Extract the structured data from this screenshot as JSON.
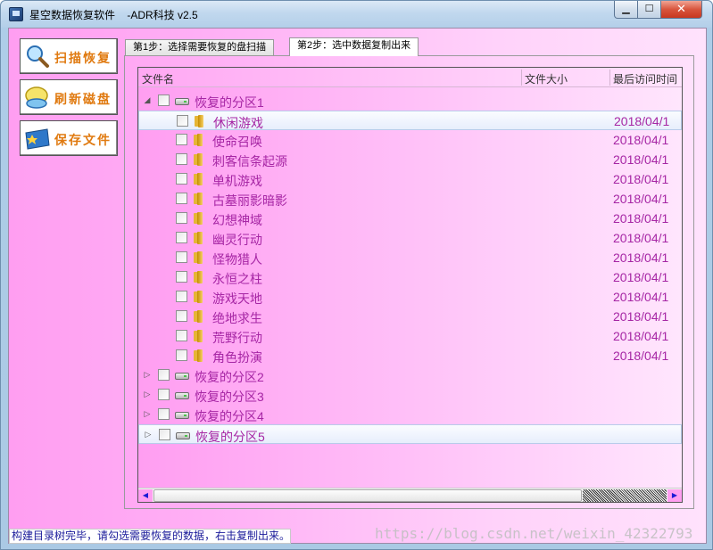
{
  "window": {
    "title": "星空数据恢复软件    -ADR科技 v2.5",
    "minimize_glyph": "▁",
    "maximize_glyph": "☐",
    "close_glyph": "✕"
  },
  "sidebar": {
    "buttons": [
      {
        "label": "扫描恢复",
        "icon": "magnifier-icon"
      },
      {
        "label": "刷新磁盘",
        "icon": "refresh-disk-icon"
      },
      {
        "label": "保存文件",
        "icon": "save-file-icon"
      }
    ]
  },
  "tabs": [
    {
      "label": "第1步：选择需要恢复的盘扫描",
      "active": false
    },
    {
      "label": "第2步：选中数据复制出来",
      "active": true
    }
  ],
  "tree": {
    "columns": [
      "文件名",
      "文件大小",
      "最后访问时间"
    ],
    "partition1": {
      "label": "恢复的分区1",
      "expanded": true
    },
    "folders": [
      {
        "name": "休闲游戏",
        "date": "2018/04/1",
        "selected": true
      },
      {
        "name": "使命召唤",
        "date": "2018/04/1"
      },
      {
        "name": "刺客信条起源",
        "date": "2018/04/1"
      },
      {
        "name": "单机游戏",
        "date": "2018/04/1"
      },
      {
        "name": "古墓丽影暗影",
        "date": "2018/04/1"
      },
      {
        "name": "幻想神域",
        "date": "2018/04/1"
      },
      {
        "name": "幽灵行动",
        "date": "2018/04/1"
      },
      {
        "name": "怪物猎人",
        "date": "2018/04/1"
      },
      {
        "name": "永恒之柱",
        "date": "2018/04/1"
      },
      {
        "name": "游戏天地",
        "date": "2018/04/1"
      },
      {
        "name": "绝地求生",
        "date": "2018/04/1"
      },
      {
        "name": "荒野行动",
        "date": "2018/04/1"
      },
      {
        "name": "角色扮演",
        "date": "2018/04/1"
      }
    ],
    "partitions_collapsed": [
      {
        "label": "恢复的分区2"
      },
      {
        "label": "恢复的分区3"
      },
      {
        "label": "恢复的分区4"
      },
      {
        "label": "恢复的分区5",
        "selected": true
      }
    ],
    "expanded_glyph": "◢",
    "collapsed_glyph": "▷"
  },
  "scrollbar": {
    "left_glyph": "◀",
    "right_glyph": "▶"
  },
  "status": {
    "text": "构建目录树完毕，请勾选需要恢复的数据，右击复制出来。"
  },
  "watermark": "https://blog.csdn.net/weixin_42322793",
  "colors": {
    "accent_text": "#a626a4",
    "background_pink": "#ff9ef1",
    "button_label": "#e07a10"
  }
}
